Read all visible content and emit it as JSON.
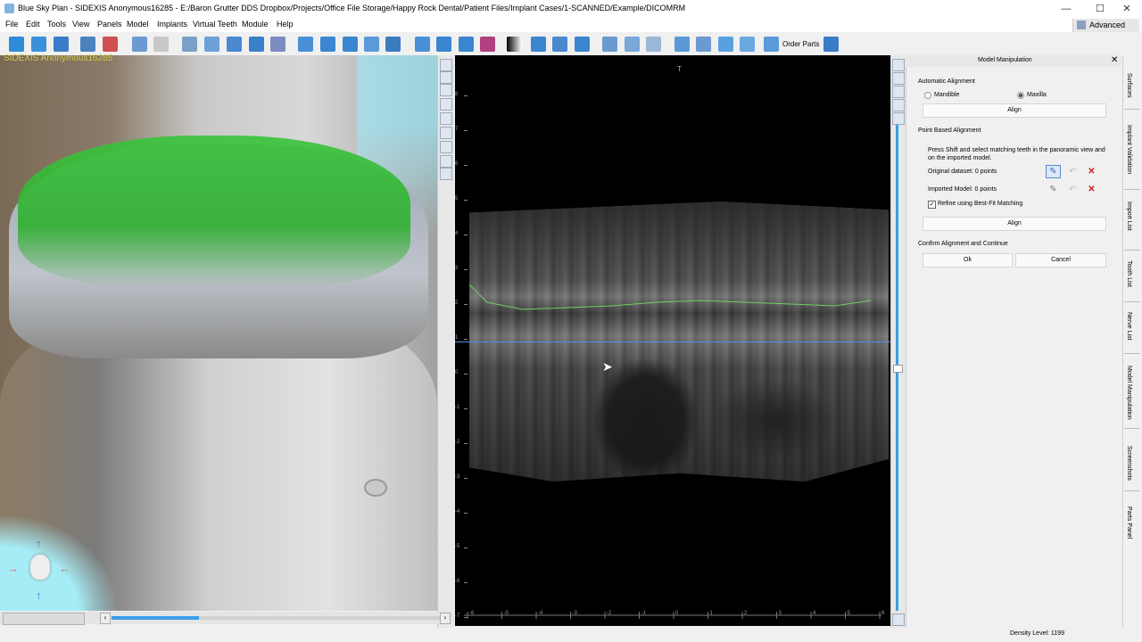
{
  "window": {
    "title": "Blue Sky Plan - SIDEXIS Anonymous16285 - E:/Baron Grutter DDS Dropbox/Projects/Office File Storage/Happy Rock Dental/Patient Files/Implant Cases/1-SCANNED/Example/DICOMRM",
    "minimize": "—",
    "maximize": "☐",
    "close": "✕"
  },
  "menu": {
    "items": [
      "File",
      "Edit",
      "Tools",
      "View",
      "Panels",
      "Model",
      "Implants",
      "Virtual Teeth",
      "Module",
      "Help"
    ],
    "advanced": "Advanced"
  },
  "toolbar": {
    "order_parts": "Order Parts"
  },
  "view3d": {
    "overlay": "SIDEXIS Anonymous16285"
  },
  "ctview": {
    "top_marker": "T",
    "left_ruler": [
      "8",
      "7",
      "6",
      "5",
      "4",
      "3",
      "2",
      "1",
      "0",
      "-1",
      "-2",
      "-3",
      "-4",
      "-5",
      "-6",
      "-7"
    ],
    "bottom_ruler": [
      "-6",
      "-5",
      "-4",
      "-3",
      "-2",
      "-1",
      "0",
      "1",
      "2",
      "3",
      "4",
      "5",
      "6"
    ]
  },
  "panel": {
    "title": "Model Manipulation",
    "close": "✕",
    "auto_heading": "Automatic Alignment",
    "radio_mandible": "Mandible",
    "radio_maxilla": "Maxilla",
    "align1": "Align",
    "point_heading": "Point Based Alignment",
    "instructions": "Press Shift and select matching teeth in the panoramic view and on the imported model.",
    "original_dataset": "Original dataset: 0 points",
    "imported_model": "Imported Model: 0 points",
    "refine": "Refine using Best-Fit Matching",
    "align2": "Align",
    "confirm_heading": "Confirm Alignment and Continue",
    "ok": "Ok",
    "cancel": "Cancel"
  },
  "tabs": [
    "Surfaces",
    "Implant Validation",
    "Import List",
    "Tooth List",
    "Nerve List",
    "Model Manipulation",
    "Screenshots",
    "Parts Panel"
  ],
  "status": {
    "density": "Density Level: 1199"
  }
}
